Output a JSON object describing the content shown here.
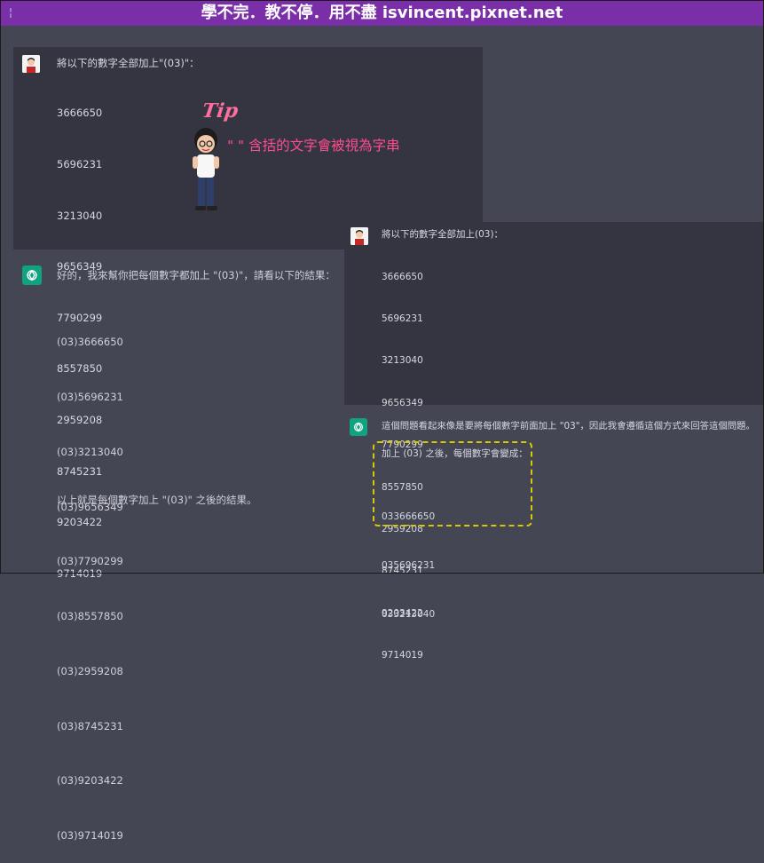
{
  "banner": {
    "title": "學不完．教不停．用不盡 isvincent.pixnet.net",
    "icon": "¦"
  },
  "left": {
    "prompt_title": "將以下的數字全部加上\"(03)\"：",
    "numbers": [
      "3666650",
      "5696231",
      "3213040",
      "9656349",
      "7790299",
      "8557850",
      "2959208",
      "8745231",
      "9203422",
      "9714019"
    ],
    "response_intro": "好的，我來幫你把每個數字都加上 \"(03)\"，請看以下的結果：",
    "response_items": [
      "(03)3666650",
      "(03)5696231",
      "(03)3213040",
      "(03)9656349",
      "(03)7790299",
      "(03)8557850",
      "(03)2959208",
      "(03)8745231",
      "(03)9203422",
      "(03)9714019"
    ],
    "response_outro": "以上就是每個數字加上 \"(03)\" 之後的結果。"
  },
  "tip": {
    "title": "Tip",
    "text": "\" \" 含括的文字會被視為字串"
  },
  "right": {
    "prompt_title": "將以下的數字全部加上(03)：",
    "numbers": [
      "3666650",
      "5696231",
      "3213040",
      "9656349",
      "7790299",
      "8557850",
      "2959208",
      "8745231",
      "9203422",
      "9714019"
    ],
    "response_intro": "這個問題看起來像是要將每個數字前面加上 \"03\"，因此我會遵循這個方式來回答這個問題。",
    "response_sub": "加上 (03) 之後，每個數字會變成：",
    "response_items": [
      "033666650",
      "035696231",
      "033213040"
    ]
  },
  "colors": {
    "banner": "#7a2fa8",
    "panel_dark": "#343541",
    "panel_light": "#444654",
    "gpt_green": "#10a37f",
    "tip_pink": "#ff4d8d",
    "dash_yellow": "#d8c800"
  }
}
